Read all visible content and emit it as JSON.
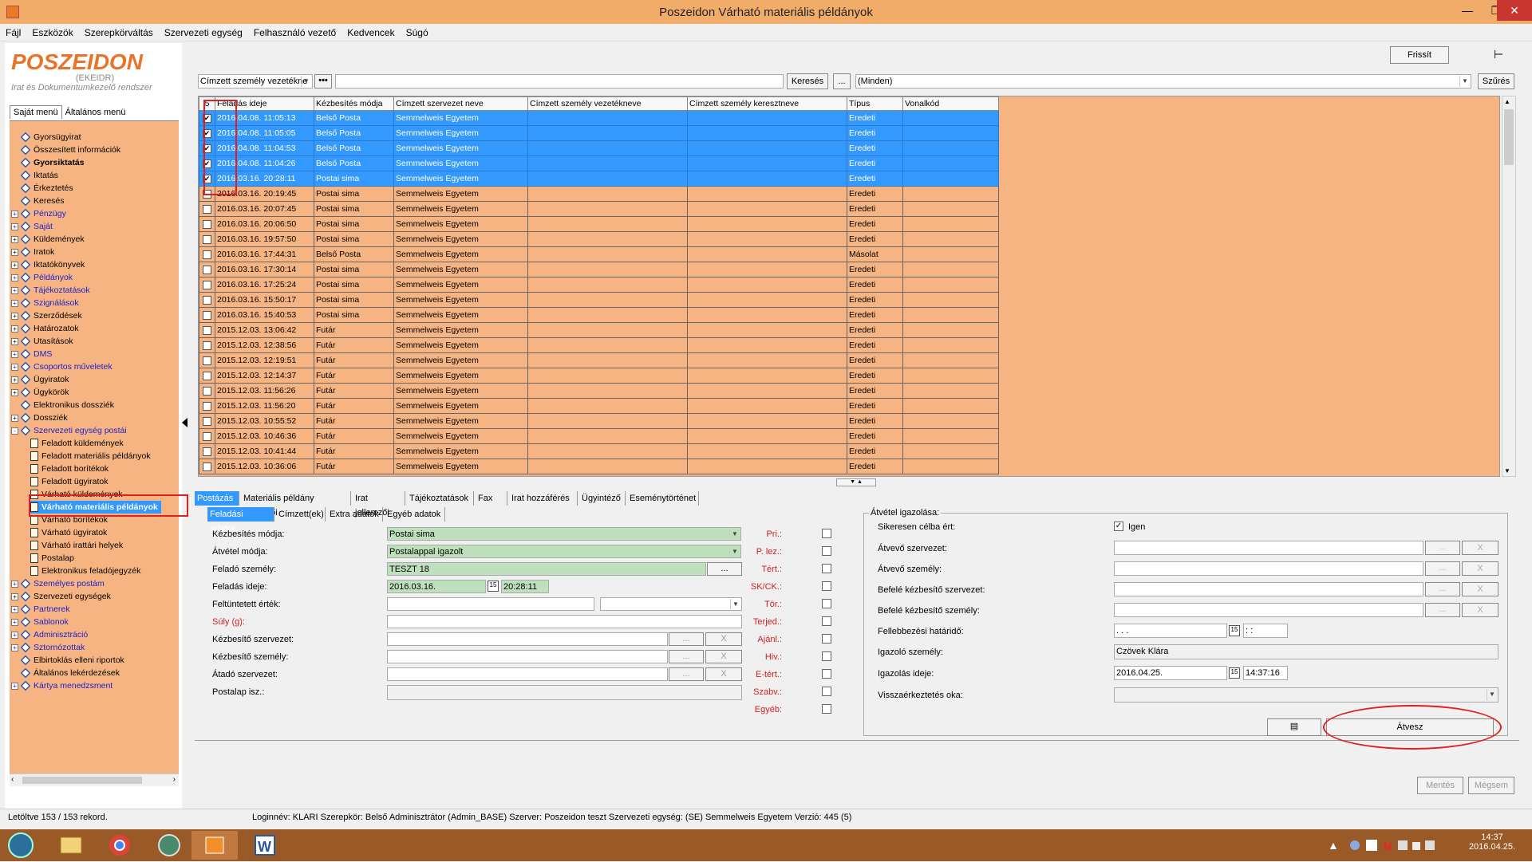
{
  "window": {
    "title": "Poszeidon Várható materiális példányok"
  },
  "menu": [
    "Fájl",
    "Eszközök",
    "Szerepkörváltás",
    "Szervezeti egység",
    "Felhasználó vezető",
    "Kedvencek",
    "Súgó"
  ],
  "logo": {
    "name": "POSZEIDON",
    "sub1": "(EKEIDR)",
    "sub2": "Irat és Dokumentumkezelő rendszer"
  },
  "left_tabs": [
    "Saját menü",
    "Általános menü"
  ],
  "tree": [
    {
      "label": "Gyorsügyirat",
      "pm": "",
      "kind": "ic",
      "style": "",
      "indent": 0
    },
    {
      "label": "Összesített információk",
      "pm": "",
      "kind": "ic",
      "style": "",
      "indent": 0
    },
    {
      "label": "Gyorsiktatás",
      "pm": "",
      "kind": "ic",
      "style": "bold",
      "indent": 0
    },
    {
      "label": "Iktatás",
      "pm": "",
      "kind": "ic",
      "style": "",
      "indent": 0
    },
    {
      "label": "Érkeztetés",
      "pm": "",
      "kind": "ic",
      "style": "",
      "indent": 0
    },
    {
      "label": "Keresés",
      "pm": "",
      "kind": "ic",
      "style": "",
      "indent": 0
    },
    {
      "label": "Pénzügy",
      "pm": "+",
      "kind": "ic",
      "style": "link",
      "indent": 0
    },
    {
      "label": "Saját",
      "pm": "+",
      "kind": "ic",
      "style": "link",
      "indent": 0
    },
    {
      "label": "Küldemények",
      "pm": "+",
      "kind": "ic",
      "style": "",
      "indent": 0
    },
    {
      "label": "Iratok",
      "pm": "+",
      "kind": "ic",
      "style": "",
      "indent": 0
    },
    {
      "label": "Iktatókönyvek",
      "pm": "+",
      "kind": "ic",
      "style": "",
      "indent": 0
    },
    {
      "label": "Példányok",
      "pm": "+",
      "kind": "ic",
      "style": "link",
      "indent": 0
    },
    {
      "label": "Tájékoztatások",
      "pm": "+",
      "kind": "ic",
      "style": "link",
      "indent": 0
    },
    {
      "label": "Szignálások",
      "pm": "+",
      "kind": "ic",
      "style": "link",
      "indent": 0
    },
    {
      "label": "Szerződések",
      "pm": "+",
      "kind": "ic",
      "style": "",
      "indent": 0
    },
    {
      "label": "Határozatok",
      "pm": "+",
      "kind": "ic",
      "style": "",
      "indent": 0
    },
    {
      "label": "Utasítások",
      "pm": "+",
      "kind": "ic",
      "style": "",
      "indent": 0
    },
    {
      "label": "DMS",
      "pm": "+",
      "kind": "ic",
      "style": "link",
      "indent": 0
    },
    {
      "label": "Csoportos műveletek",
      "pm": "+",
      "kind": "ic",
      "style": "link",
      "indent": 0
    },
    {
      "label": "Ügyiratok",
      "pm": "+",
      "kind": "ic",
      "style": "",
      "indent": 0
    },
    {
      "label": "Ügykörök",
      "pm": "+",
      "kind": "ic",
      "style": "",
      "indent": 0
    },
    {
      "label": "Elektronikus dossziék",
      "pm": "",
      "kind": "ic",
      "style": "",
      "indent": 0
    },
    {
      "label": "Dossziék",
      "pm": "+",
      "kind": "ic",
      "style": "",
      "indent": 0
    },
    {
      "label": "Szervezeti egység postái",
      "pm": "-",
      "kind": "ic",
      "style": "link",
      "indent": 0
    },
    {
      "label": "Feladott küldemények",
      "pm": "",
      "kind": "doc",
      "style": "",
      "indent": 1
    },
    {
      "label": "Feladott materiális példányok",
      "pm": "",
      "kind": "doc",
      "style": "",
      "indent": 1
    },
    {
      "label": "Feladott borítékok",
      "pm": "",
      "kind": "doc",
      "style": "",
      "indent": 1
    },
    {
      "label": "Feladott ügyiratok",
      "pm": "",
      "kind": "doc",
      "style": "",
      "indent": 1
    },
    {
      "label": "Várható küldemények",
      "pm": "",
      "kind": "doc",
      "style": "",
      "indent": 1
    },
    {
      "label": "Várható materiális példányok",
      "pm": "",
      "kind": "doc",
      "style": "selected",
      "indent": 1
    },
    {
      "label": "Várható borítékok",
      "pm": "",
      "kind": "doc",
      "style": "",
      "indent": 1
    },
    {
      "label": "Várható ügyiratok",
      "pm": "",
      "kind": "doc",
      "style": "",
      "indent": 1
    },
    {
      "label": "Várható irattári helyek",
      "pm": "",
      "kind": "doc",
      "style": "",
      "indent": 1
    },
    {
      "label": "Postalap",
      "pm": "",
      "kind": "doc",
      "style": "",
      "indent": 1
    },
    {
      "label": "Elektronikus feladójegyzék",
      "pm": "",
      "kind": "doc",
      "style": "",
      "indent": 1
    },
    {
      "label": "Személyes postám",
      "pm": "+",
      "kind": "ic",
      "style": "link",
      "indent": 0
    },
    {
      "label": "Szervezeti egységek",
      "pm": "+",
      "kind": "ic",
      "style": "",
      "indent": 0
    },
    {
      "label": "Partnerek",
      "pm": "+",
      "kind": "ic",
      "style": "link",
      "indent": 0
    },
    {
      "label": "Sablonok",
      "pm": "+",
      "kind": "ic",
      "style": "link",
      "indent": 0
    },
    {
      "label": "Adminisztráció",
      "pm": "+",
      "kind": "ic",
      "style": "link",
      "indent": 0
    },
    {
      "label": "Sztornózottak",
      "pm": "+",
      "kind": "ic",
      "style": "link",
      "indent": 0
    },
    {
      "label": "Elbirtoklás elleni riportok",
      "pm": "",
      "kind": "ic",
      "style": "",
      "indent": 0
    },
    {
      "label": "Általános lekérdezések",
      "pm": "",
      "kind": "ic",
      "style": "",
      "indent": 0
    },
    {
      "label": "Kártya menedzsment",
      "pm": "+",
      "kind": "ic",
      "style": "link",
      "indent": 0
    }
  ],
  "toolbar": {
    "refresh_label": "Frissít",
    "search_field_value": "Címzett személy vezetékne",
    "search_text_value": "",
    "search_button": "Keresés",
    "ellipsis_button": "...",
    "filter_value": "(Minden)",
    "filter_button": "Szűrés"
  },
  "grid": {
    "selected_count": "5",
    "columns": [
      "Feladás ideje",
      "Kézbesítés módja",
      "Címzett szervezet neve",
      "Címzett személy vezetékneve",
      "Címzett személy keresztneve",
      "Típus",
      "Vonalkód"
    ],
    "rows": [
      {
        "checked": true,
        "sel": true,
        "date": "2016.04.08. 11:05:13",
        "mode": "Belső Posta",
        "org": "Semmelweis Egyetem",
        "ln": "",
        "fn": "",
        "type": "Eredeti",
        "bc": ""
      },
      {
        "checked": true,
        "sel": true,
        "date": "2016.04.08. 11:05:05",
        "mode": "Belső Posta",
        "org": "Semmelweis Egyetem",
        "ln": "",
        "fn": "",
        "type": "Eredeti",
        "bc": ""
      },
      {
        "checked": true,
        "sel": true,
        "date": "2016.04.08. 11:04:53",
        "mode": "Belső Posta",
        "org": "Semmelweis Egyetem",
        "ln": "",
        "fn": "",
        "type": "Eredeti",
        "bc": ""
      },
      {
        "checked": true,
        "sel": true,
        "date": "2016.04.08. 11:04:26",
        "mode": "Belső Posta",
        "org": "Semmelweis Egyetem",
        "ln": "",
        "fn": "",
        "type": "Eredeti",
        "bc": ""
      },
      {
        "checked": true,
        "sel": true,
        "date": "2016.03.16. 20:28:11",
        "mode": "Postai sima",
        "org": "Semmelweis Egyetem",
        "ln": "",
        "fn": "",
        "type": "Eredeti",
        "bc": ""
      },
      {
        "checked": false,
        "sel": false,
        "date": "2016.03.16. 20:19:45",
        "mode": "Postai sima",
        "org": "Semmelweis Egyetem",
        "ln": "",
        "fn": "",
        "type": "Eredeti",
        "bc": ""
      },
      {
        "checked": false,
        "sel": false,
        "date": "2016.03.16. 20:07:45",
        "mode": "Postai sima",
        "org": "Semmelweis Egyetem",
        "ln": "",
        "fn": "",
        "type": "Eredeti",
        "bc": ""
      },
      {
        "checked": false,
        "sel": false,
        "date": "2016.03.16. 20:06:50",
        "mode": "Postai sima",
        "org": "Semmelweis Egyetem",
        "ln": "",
        "fn": "",
        "type": "Eredeti",
        "bc": ""
      },
      {
        "checked": false,
        "sel": false,
        "date": "2016.03.16. 19:57:50",
        "mode": "Postai sima",
        "org": "Semmelweis Egyetem",
        "ln": "",
        "fn": "",
        "type": "Eredeti",
        "bc": ""
      },
      {
        "checked": false,
        "sel": false,
        "date": "2016.03.16. 17:44:31",
        "mode": "Belső Posta",
        "org": "Semmelweis Egyetem",
        "ln": "",
        "fn": "",
        "type": "Másolat",
        "bc": ""
      },
      {
        "checked": false,
        "sel": false,
        "date": "2016.03.16. 17:30:14",
        "mode": "Postai sima",
        "org": "Semmelweis Egyetem",
        "ln": "",
        "fn": "",
        "type": "Eredeti",
        "bc": ""
      },
      {
        "checked": false,
        "sel": false,
        "date": "2016.03.16. 17:25:24",
        "mode": "Postai sima",
        "org": "Semmelweis Egyetem",
        "ln": "",
        "fn": "",
        "type": "Eredeti",
        "bc": ""
      },
      {
        "checked": false,
        "sel": false,
        "date": "2016.03.16. 15:50:17",
        "mode": "Postai sima",
        "org": "Semmelweis Egyetem",
        "ln": "",
        "fn": "",
        "type": "Eredeti",
        "bc": ""
      },
      {
        "checked": false,
        "sel": false,
        "date": "2016.03.16. 15:40:53",
        "mode": "Postai sima",
        "org": "Semmelweis Egyetem",
        "ln": "",
        "fn": "",
        "type": "Eredeti",
        "bc": ""
      },
      {
        "checked": false,
        "sel": false,
        "date": "2015.12.03. 13:06:42",
        "mode": "Futár",
        "org": "Semmelweis Egyetem",
        "ln": "",
        "fn": "",
        "type": "Eredeti",
        "bc": ""
      },
      {
        "checked": false,
        "sel": false,
        "date": "2015.12.03. 12:38:56",
        "mode": "Futár",
        "org": "Semmelweis Egyetem",
        "ln": "",
        "fn": "",
        "type": "Eredeti",
        "bc": ""
      },
      {
        "checked": false,
        "sel": false,
        "date": "2015.12.03. 12:19:51",
        "mode": "Futár",
        "org": "Semmelweis Egyetem",
        "ln": "",
        "fn": "",
        "type": "Eredeti",
        "bc": ""
      },
      {
        "checked": false,
        "sel": false,
        "date": "2015.12.03. 12:14:37",
        "mode": "Futár",
        "org": "Semmelweis Egyetem",
        "ln": "",
        "fn": "",
        "type": "Eredeti",
        "bc": ""
      },
      {
        "checked": false,
        "sel": false,
        "date": "2015.12.03. 11:56:26",
        "mode": "Futár",
        "org": "Semmelweis Egyetem",
        "ln": "",
        "fn": "",
        "type": "Eredeti",
        "bc": ""
      },
      {
        "checked": false,
        "sel": false,
        "date": "2015.12.03. 11:56:20",
        "mode": "Futár",
        "org": "Semmelweis Egyetem",
        "ln": "",
        "fn": "",
        "type": "Eredeti",
        "bc": ""
      },
      {
        "checked": false,
        "sel": false,
        "date": "2015.12.03. 10:55:52",
        "mode": "Futár",
        "org": "Semmelweis Egyetem",
        "ln": "",
        "fn": "",
        "type": "Eredeti",
        "bc": ""
      },
      {
        "checked": false,
        "sel": false,
        "date": "2015.12.03. 10:46:36",
        "mode": "Futár",
        "org": "Semmelweis Egyetem",
        "ln": "",
        "fn": "",
        "type": "Eredeti",
        "bc": ""
      },
      {
        "checked": false,
        "sel": false,
        "date": "2015.12.03. 10:41:44",
        "mode": "Futár",
        "org": "Semmelweis Egyetem",
        "ln": "",
        "fn": "",
        "type": "Eredeti",
        "bc": ""
      },
      {
        "checked": false,
        "sel": false,
        "date": "2015.12.03. 10:36:06",
        "mode": "Futár",
        "org": "Semmelweis Egyetem",
        "ln": "",
        "fn": "",
        "type": "Eredeti",
        "bc": ""
      }
    ]
  },
  "bottom_tabs": [
    "Postázás",
    "Materiális példány jellemzői",
    "Irat jellemzői",
    "Tájékoztatások",
    "Fax",
    "Irat hozzáférés",
    "Ügyintéző",
    "Eseménytörténet"
  ],
  "sub_tabs": [
    "Feladási adatok",
    "Címzett(ek)",
    "Extra adatok",
    "Egyéb adatok"
  ],
  "form": {
    "kezbesites_modja_label": "Kézbesítés módja:",
    "kezbesites_modja": "Postai sima",
    "atvetel_modja_label": "Átvétel módja:",
    "atvetel_modja": "Postalappal igazolt",
    "felado_szemely_label": "Feladó személy:",
    "felado_szemely": "TESZT 18",
    "feladas_ideje_label": "Feladás ideje:",
    "feladas_datum": "2016.03.16.",
    "feladas_ido": "20:28:11",
    "feltuntetett_ertek_label": "Feltüntetett érték:",
    "suly_label": "Súly (g):",
    "kezbesito_szervezet_label": "Kézbesítő szervezet:",
    "kezbesito_szemely_label": "Kézbesítő személy:",
    "atado_szervezet_label": "Átadó szervezet:",
    "postalap_label": "Postalap isz.:",
    "dots": "...",
    "x": "X",
    "flags": [
      "Pri.:",
      "P. lez.:",
      "Tért.:",
      "SK/CK.:",
      "Tör.:",
      "Terjed.:",
      "Ajánl.:",
      "Hiv.:",
      "E-tért.:",
      "Szabv.:",
      "Egyéb:"
    ]
  },
  "atvetel": {
    "group_title": "Átvétel igazolása:",
    "sikeresen_label": "Sikeresen célba ért:",
    "sikeresen_value": "Igen",
    "atvevo_szervezet_label": "Átvevő szervezet:",
    "atvevo_szemely_label": "Átvevő személy:",
    "befele_szervezet_label": "Befelé kézbesítő szervezet:",
    "befele_szemely_label": "Befelé kézbesítő személy:",
    "fellebbezesi_label": "Fellebbezési határidő:",
    "fellebbezesi_datum": ". . .",
    "fellebbezesi_ido": ": :",
    "igazolo_szemely_label": "Igazoló személy:",
    "igazolo_szemely": "Czövek Klára",
    "igazolas_ideje_label": "Igazolás ideje:",
    "igazolas_datum": "2016.04.25.",
    "igazolas_ido": "14:37:16",
    "vissza_label": "Visszaérkeztetés oka:",
    "atvesz_button": "Átvesz"
  },
  "bottom_buttons": {
    "save": "Mentés",
    "cancel": "Mégsem"
  },
  "status": {
    "records": "Letöltve 153 / 153 rekord.",
    "info": "Loginnév: KLARI  Szerepkör: Belső Adminisztrátor (Admin_BASE)  Szerver: Poszeidon teszt  Szervezeti egység: (SE) Semmelweis Egyetem  Verzió: 445 (5)"
  },
  "clock": {
    "time": "14:37",
    "date": "2016.04.25."
  }
}
